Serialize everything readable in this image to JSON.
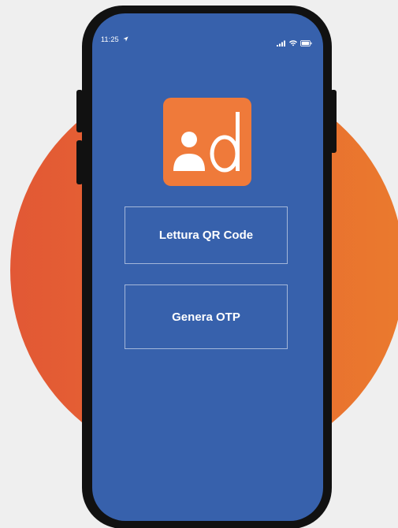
{
  "status_bar": {
    "time": "11:25",
    "location_icon": "location-arrow-icon",
    "signal_icon": "cellular-signal-icon",
    "wifi_icon": "wifi-icon",
    "battery_icon": "battery-icon"
  },
  "app": {
    "logo_icon": "app-logo-icon",
    "buttons": [
      {
        "label": "Lettura QR Code"
      },
      {
        "label": "Genera OTP"
      }
    ]
  },
  "colors": {
    "page_background": "#efefef",
    "screen_background": "#3761ac",
    "logo_background": "#ef7a3a",
    "circle_left": "#e25835",
    "circle_right": "#ea7a2e",
    "phone_frame": "#111111"
  }
}
